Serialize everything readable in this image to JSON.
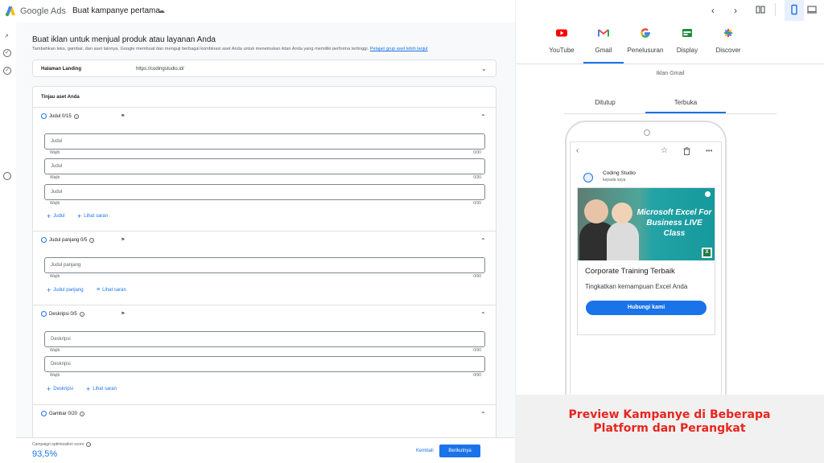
{
  "app": {
    "brand": "Google Ads",
    "campaign_title": "Buat kampanye pertama"
  },
  "editor": {
    "heading": "Buat iklan untuk menjual produk atau layanan Anda",
    "subheading": "Tambahkan teks, gambar, dan aset lainnya. Google membuat dan menguji berbagai kombinasi aset Anda untuk menemukan iklan Anda yang memiliki performa tertinggi.",
    "subheading_link": "Pelajari grup aset lebih lanjut",
    "landing": {
      "label": "Halaman Landing",
      "value": "https://codingstudio.id/"
    },
    "review_title": "Tinjau aset Anda",
    "headlines": {
      "title": "Judul 0/15",
      "fields": [
        "Judul",
        "Judul",
        "Judul"
      ],
      "required": "Wajib",
      "count": "0/30",
      "add_label": "Judul",
      "suggest_label": "Lihat saran"
    },
    "long_headlines": {
      "title": "Judul panjang 0/5",
      "fields": [
        "Judul panjang"
      ],
      "required": "Wajib",
      "count": "0/90",
      "add_label": "Judul panjang",
      "suggest_label": "Lihat saran"
    },
    "descriptions": {
      "title": "Deskripsi 0/5",
      "fields": [
        "Deskripsi",
        "Deskripsi"
      ],
      "required": "Wajib",
      "count": "0/90",
      "add_label": "Deskripsi",
      "suggest_label": "Lihat saran"
    },
    "images": {
      "title": "Gambar 0/20"
    },
    "footer": {
      "score_label": "Campaign optimization score",
      "score_value": "93,5%",
      "back_label": "Kembali",
      "next_label": "Berikutnya"
    }
  },
  "preview": {
    "platforms": [
      {
        "label": "YouTube",
        "icon": "youtube-icon"
      },
      {
        "label": "Gmail",
        "icon": "gmail-icon"
      },
      {
        "label": "Penelusuran",
        "icon": "google-search-icon"
      },
      {
        "label": "Display",
        "icon": "display-icon"
      },
      {
        "label": "Discover",
        "icon": "discover-icon"
      }
    ],
    "selected_platform": "Gmail",
    "ad_type": "Iklan Gmail",
    "toggles": [
      "Ditutup",
      "Terbuka"
    ],
    "selected_toggle": "Terbuka",
    "sender": "Coding Studio",
    "to_me": "kepada saya",
    "banner_text": "Microsoft Excel For Business LIVE Class",
    "ad_headline": "Corporate Training Terbaik",
    "ad_description": "Tingkatkan kemampuan Excel Anda",
    "cta": "Hubungi kami"
  },
  "promo": {
    "text": "Preview Kampanye di Beberapa Platform dan Perangkat"
  },
  "colors": {
    "accent": "#1a73e8",
    "promo_red": "#e8251f",
    "excel_green": "#1e7e45"
  }
}
